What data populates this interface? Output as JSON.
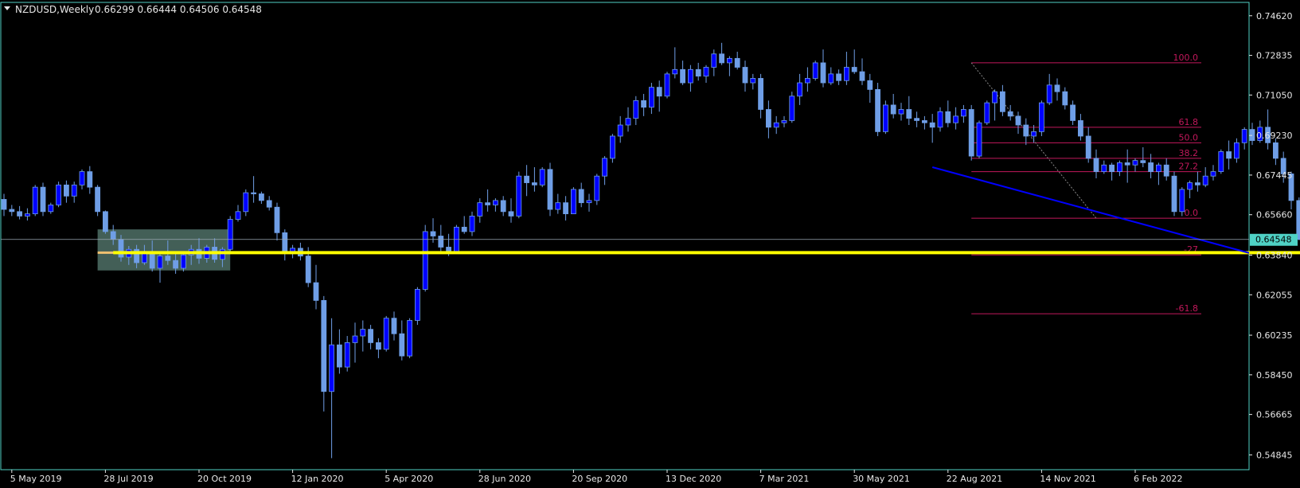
{
  "header": {
    "symbol": "NZDUSD,Weekly",
    "ohlc": "0.66299 0.66444 0.64506 0.64548"
  },
  "colors": {
    "background": "#000000",
    "frame": "#4fd1c5",
    "bull_body": "#0000ff",
    "bear_body": "#6f9ee6",
    "wick": "#6f9ee6",
    "trendline": "#0000ff",
    "support": "#ffff00",
    "fibo": "#c2185b",
    "price_label_bg": "#4fd1c5",
    "zone": "#5a7f74",
    "zone_line": "#f0c070"
  },
  "price_label": "0.64548",
  "chart_data": {
    "type": "candlestick",
    "title": "NZDUSD,Weekly",
    "ylim": [
      0.5425,
      0.7515
    ],
    "y_ticks": [
      "0.74620",
      "0.72835",
      "0.71050",
      "0.69230",
      "0.67445",
      "0.65660",
      "0.63840",
      "0.62055",
      "0.60235",
      "0.58450",
      "0.56665",
      "0.54845"
    ],
    "x_tick_labels": [
      "5 May 2019",
      "28 Jul 2019",
      "20 Oct 2019",
      "12 Jan 2020",
      "5 Apr 2020",
      "28 Jun 2020",
      "20 Sep 2020",
      "13 Dec 2020",
      "7 Mar 2021",
      "30 May 2021",
      "22 Aug 2021",
      "14 Nov 2021",
      "6 Feb 2022"
    ],
    "grid": false,
    "last_price": 0.64548,
    "candles": [
      [
        0.6635,
        0.666,
        0.656,
        0.659
      ],
      [
        0.659,
        0.661,
        0.656,
        0.658
      ],
      [
        0.658,
        0.6605,
        0.6545,
        0.656
      ],
      [
        0.656,
        0.6595,
        0.654,
        0.657
      ],
      [
        0.657,
        0.67,
        0.656,
        0.669
      ],
      [
        0.669,
        0.671,
        0.656,
        0.658
      ],
      [
        0.658,
        0.662,
        0.657,
        0.661
      ],
      [
        0.661,
        0.6715,
        0.66,
        0.67
      ],
      [
        0.67,
        0.672,
        0.662,
        0.665
      ],
      [
        0.665,
        0.6715,
        0.662,
        0.67
      ],
      [
        0.67,
        0.677,
        0.668,
        0.676
      ],
      [
        0.676,
        0.6785,
        0.666,
        0.669
      ],
      [
        0.669,
        0.67,
        0.656,
        0.658
      ],
      [
        0.658,
        0.6585,
        0.648,
        0.649
      ],
      [
        0.649,
        0.652,
        0.643,
        0.6455
      ],
      [
        0.6455,
        0.6475,
        0.6355,
        0.6375
      ],
      [
        0.6375,
        0.6425,
        0.634,
        0.641
      ],
      [
        0.641,
        0.643,
        0.6325,
        0.635
      ],
      [
        0.635,
        0.643,
        0.634,
        0.64
      ],
      [
        0.64,
        0.645,
        0.631,
        0.6325
      ],
      [
        0.6325,
        0.64,
        0.626,
        0.638
      ],
      [
        0.638,
        0.645,
        0.634,
        0.636
      ],
      [
        0.636,
        0.64,
        0.63,
        0.6325
      ],
      [
        0.6325,
        0.64,
        0.631,
        0.6385
      ],
      [
        0.6385,
        0.643,
        0.634,
        0.641
      ],
      [
        0.641,
        0.646,
        0.6345,
        0.637
      ],
      [
        0.637,
        0.643,
        0.635,
        0.642
      ],
      [
        0.642,
        0.646,
        0.635,
        0.6365
      ],
      [
        0.6365,
        0.642,
        0.633,
        0.641
      ],
      [
        0.641,
        0.656,
        0.64,
        0.6545
      ],
      [
        0.6545,
        0.661,
        0.6535,
        0.658
      ],
      [
        0.658,
        0.668,
        0.656,
        0.6665
      ],
      [
        0.6665,
        0.674,
        0.662,
        0.666
      ],
      [
        0.666,
        0.667,
        0.6615,
        0.663
      ],
      [
        0.663,
        0.665,
        0.6585,
        0.66
      ],
      [
        0.66,
        0.662,
        0.645,
        0.6485
      ],
      [
        0.6485,
        0.65,
        0.636,
        0.64
      ],
      [
        0.64,
        0.643,
        0.637,
        0.6415
      ],
      [
        0.6415,
        0.644,
        0.636,
        0.638
      ],
      [
        0.638,
        0.642,
        0.624,
        0.626
      ],
      [
        0.626,
        0.634,
        0.614,
        0.618
      ],
      [
        0.618,
        0.62,
        0.568,
        0.577
      ],
      [
        0.577,
        0.61,
        0.547,
        0.598
      ],
      [
        0.598,
        0.605,
        0.585,
        0.588
      ],
      [
        0.588,
        0.602,
        0.586,
        0.599
      ],
      [
        0.599,
        0.608,
        0.59,
        0.602
      ],
      [
        0.602,
        0.609,
        0.595,
        0.605
      ],
      [
        0.605,
        0.607,
        0.596,
        0.599
      ],
      [
        0.599,
        0.601,
        0.592,
        0.596
      ],
      [
        0.596,
        0.611,
        0.595,
        0.61
      ],
      [
        0.61,
        0.613,
        0.6,
        0.603
      ],
      [
        0.603,
        0.609,
        0.591,
        0.593
      ],
      [
        0.593,
        0.61,
        0.592,
        0.609
      ],
      [
        0.609,
        0.624,
        0.607,
        0.623
      ],
      [
        0.623,
        0.652,
        0.622,
        0.649
      ],
      [
        0.649,
        0.655,
        0.644,
        0.647
      ],
      [
        0.647,
        0.652,
        0.639,
        0.642
      ],
      [
        0.642,
        0.648,
        0.638,
        0.64
      ],
      [
        0.64,
        0.652,
        0.639,
        0.651
      ],
      [
        0.651,
        0.656,
        0.648,
        0.649
      ],
      [
        0.649,
        0.658,
        0.647,
        0.656
      ],
      [
        0.656,
        0.664,
        0.653,
        0.662
      ],
      [
        0.662,
        0.668,
        0.658,
        0.661
      ],
      [
        0.661,
        0.664,
        0.658,
        0.663
      ],
      [
        0.663,
        0.665,
        0.656,
        0.658
      ],
      [
        0.658,
        0.664,
        0.653,
        0.656
      ],
      [
        0.656,
        0.676,
        0.655,
        0.674
      ],
      [
        0.674,
        0.679,
        0.665,
        0.671
      ],
      [
        0.671,
        0.678,
        0.667,
        0.67
      ],
      [
        0.67,
        0.678,
        0.669,
        0.677
      ],
      [
        0.677,
        0.68,
        0.656,
        0.659
      ],
      [
        0.659,
        0.666,
        0.657,
        0.662
      ],
      [
        0.662,
        0.665,
        0.654,
        0.657
      ],
      [
        0.657,
        0.669,
        0.657,
        0.668
      ],
      [
        0.668,
        0.671,
        0.66,
        0.662
      ],
      [
        0.662,
        0.666,
        0.658,
        0.663
      ],
      [
        0.663,
        0.675,
        0.661,
        0.674
      ],
      [
        0.674,
        0.683,
        0.67,
        0.682
      ],
      [
        0.682,
        0.693,
        0.68,
        0.692
      ],
      [
        0.692,
        0.701,
        0.689,
        0.697
      ],
      [
        0.697,
        0.705,
        0.694,
        0.7
      ],
      [
        0.7,
        0.71,
        0.697,
        0.708
      ],
      [
        0.708,
        0.711,
        0.701,
        0.705
      ],
      [
        0.705,
        0.716,
        0.702,
        0.714
      ],
      [
        0.714,
        0.717,
        0.703,
        0.71
      ],
      [
        0.71,
        0.721,
        0.709,
        0.72
      ],
      [
        0.72,
        0.732,
        0.718,
        0.722
      ],
      [
        0.722,
        0.726,
        0.715,
        0.716
      ],
      [
        0.716,
        0.724,
        0.712,
        0.722
      ],
      [
        0.722,
        0.725,
        0.717,
        0.719
      ],
      [
        0.719,
        0.724,
        0.716,
        0.723
      ],
      [
        0.723,
        0.731,
        0.719,
        0.729
      ],
      [
        0.729,
        0.734,
        0.724,
        0.725
      ],
      [
        0.725,
        0.728,
        0.719,
        0.727
      ],
      [
        0.727,
        0.73,
        0.722,
        0.723
      ],
      [
        0.723,
        0.726,
        0.712,
        0.716
      ],
      [
        0.716,
        0.72,
        0.713,
        0.718
      ],
      [
        0.718,
        0.72,
        0.7,
        0.704
      ],
      [
        0.704,
        0.708,
        0.691,
        0.696
      ],
      [
        0.696,
        0.701,
        0.693,
        0.698
      ],
      [
        0.698,
        0.701,
        0.696,
        0.699
      ],
      [
        0.699,
        0.712,
        0.698,
        0.71
      ],
      [
        0.71,
        0.72,
        0.706,
        0.716
      ],
      [
        0.716,
        0.723,
        0.712,
        0.718
      ],
      [
        0.718,
        0.726,
        0.717,
        0.725
      ],
      [
        0.725,
        0.731,
        0.714,
        0.716
      ],
      [
        0.716,
        0.723,
        0.715,
        0.72
      ],
      [
        0.72,
        0.722,
        0.715,
        0.717
      ],
      [
        0.717,
        0.73,
        0.715,
        0.723
      ],
      [
        0.723,
        0.731,
        0.72,
        0.721
      ],
      [
        0.721,
        0.727,
        0.715,
        0.717
      ],
      [
        0.717,
        0.72,
        0.707,
        0.713
      ],
      [
        0.713,
        0.716,
        0.692,
        0.694
      ],
      [
        0.694,
        0.708,
        0.693,
        0.706
      ],
      [
        0.706,
        0.711,
        0.7,
        0.702
      ],
      [
        0.702,
        0.707,
        0.699,
        0.704
      ],
      [
        0.704,
        0.71,
        0.697,
        0.7
      ],
      [
        0.7,
        0.703,
        0.696,
        0.699
      ],
      [
        0.699,
        0.701,
        0.695,
        0.698
      ],
      [
        0.698,
        0.702,
        0.689,
        0.696
      ],
      [
        0.696,
        0.705,
        0.694,
        0.703
      ],
      [
        0.703,
        0.708,
        0.696,
        0.698
      ],
      [
        0.698,
        0.705,
        0.695,
        0.701
      ],
      [
        0.701,
        0.706,
        0.698,
        0.704
      ],
      [
        0.704,
        0.706,
        0.681,
        0.683
      ],
      [
        0.683,
        0.699,
        0.682,
        0.698
      ],
      [
        0.698,
        0.708,
        0.697,
        0.707
      ],
      [
        0.707,
        0.713,
        0.699,
        0.712
      ],
      [
        0.712,
        0.715,
        0.701,
        0.703
      ],
      [
        0.703,
        0.706,
        0.699,
        0.701
      ],
      [
        0.701,
        0.703,
        0.693,
        0.697
      ],
      [
        0.697,
        0.7,
        0.688,
        0.692
      ],
      [
        0.692,
        0.697,
        0.689,
        0.694
      ],
      [
        0.694,
        0.708,
        0.692,
        0.707
      ],
      [
        0.707,
        0.72,
        0.706,
        0.715
      ],
      [
        0.715,
        0.718,
        0.708,
        0.712
      ],
      [
        0.712,
        0.714,
        0.704,
        0.706
      ],
      [
        0.706,
        0.708,
        0.697,
        0.699
      ],
      [
        0.699,
        0.702,
        0.69,
        0.692
      ],
      [
        0.692,
        0.696,
        0.68,
        0.682
      ],
      [
        0.682,
        0.686,
        0.673,
        0.676
      ],
      [
        0.676,
        0.681,
        0.675,
        0.679
      ],
      [
        0.679,
        0.68,
        0.672,
        0.676
      ],
      [
        0.676,
        0.681,
        0.674,
        0.68
      ],
      [
        0.68,
        0.686,
        0.671,
        0.679
      ],
      [
        0.679,
        0.682,
        0.676,
        0.681
      ],
      [
        0.681,
        0.687,
        0.678,
        0.68
      ],
      [
        0.68,
        0.684,
        0.673,
        0.676
      ],
      [
        0.676,
        0.68,
        0.67,
        0.679
      ],
      [
        0.679,
        0.682,
        0.672,
        0.674
      ],
      [
        0.674,
        0.676,
        0.656,
        0.658
      ],
      [
        0.658,
        0.669,
        0.656,
        0.668
      ],
      [
        0.668,
        0.672,
        0.664,
        0.671
      ],
      [
        0.671,
        0.676,
        0.667,
        0.67
      ],
      [
        0.67,
        0.678,
        0.669,
        0.674
      ],
      [
        0.674,
        0.679,
        0.672,
        0.676
      ],
      [
        0.676,
        0.686,
        0.675,
        0.685
      ],
      [
        0.685,
        0.69,
        0.677,
        0.682
      ],
      [
        0.682,
        0.691,
        0.68,
        0.689
      ],
      [
        0.689,
        0.696,
        0.686,
        0.695
      ],
      [
        0.695,
        0.698,
        0.688,
        0.69
      ],
      [
        0.69,
        0.699,
        0.689,
        0.696
      ],
      [
        0.696,
        0.704,
        0.686,
        0.689
      ],
      [
        0.689,
        0.691,
        0.679,
        0.682
      ],
      [
        0.682,
        0.685,
        0.671,
        0.675
      ],
      [
        0.675,
        0.676,
        0.659,
        0.663
      ],
      [
        0.663,
        0.6644,
        0.6451,
        0.6455
      ]
    ],
    "annotations": {
      "trendline": [
        {
          "date": "2021-08-01",
          "price": 0.678
        },
        {
          "date": "2022-05-15",
          "price": 0.639
        }
      ],
      "support_level": 0.6395,
      "fibonacci": {
        "levels": [
          {
            "label": "100.0",
            "price": 0.725
          },
          {
            "label": "61.8",
            "price": 0.696
          },
          {
            "label": "50.0",
            "price": 0.689
          },
          {
            "label": "38.2",
            "price": 0.682
          },
          {
            "label": "27.2",
            "price": 0.676
          },
          {
            "label": "0.0",
            "price": 0.655
          },
          {
            "label": "-27",
            "price": 0.6385
          },
          {
            "label": "-61.8",
            "price": 0.612
          }
        ]
      },
      "consolidation_zone": {
        "from": "2019-07-14",
        "to": "2019-11-10",
        "price_high": 0.65,
        "price_low": 0.6315
      }
    }
  }
}
